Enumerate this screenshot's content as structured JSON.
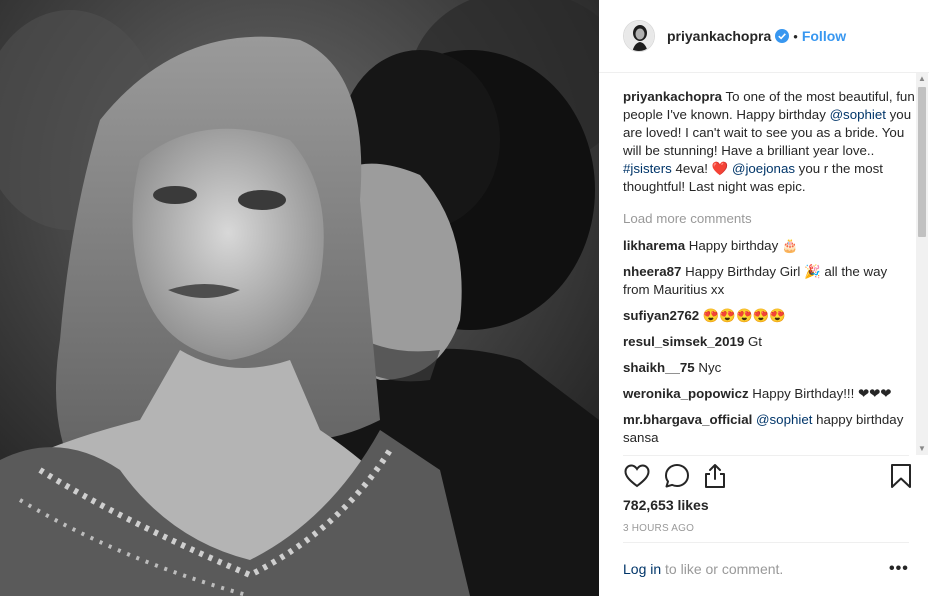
{
  "post": {
    "username": "priyankachopra",
    "follow_label": "Follow",
    "separator": "•",
    "caption": {
      "username": "priyankachopra",
      "text1": " To one of the most beautiful, fun people I've known. Happy birthday ",
      "mention1": "@sophiet",
      "text2": " you are loved! I can't wait to see you as a bride. You will be stunning! Have a brilliant year love.. ",
      "hashtag": "#jsisters",
      "text3": " 4eva! ❤️ ",
      "mention2": "@joejonas",
      "text4": " you r the most thoughtful! Last night was epic."
    },
    "load_more_label": "Load more comments",
    "comments": [
      {
        "user": "likharema",
        "text": " Happy birthday 🎂"
      },
      {
        "user": "nheera87",
        "text": " Happy Birthday Girl 🎉 all the way from Mauritius xx"
      },
      {
        "user": "sufiyan2762",
        "text": " 😍😍😍😍😍"
      },
      {
        "user": "resul_simsek_2019",
        "text": " Gt"
      },
      {
        "user": "shaikh__75",
        "text": " Nyc"
      },
      {
        "user": "weronika_popowicz",
        "text": " Happy Birthday!!! ❤❤❤"
      }
    ],
    "last_comment": {
      "user": "mr.bhargava_official",
      "mention": "@sophiet",
      "text": " happy birthday sansa"
    },
    "likes": "782,653 likes",
    "time": "3 HOURS AGO",
    "footer": {
      "login": "Log in",
      "rest": " to like or comment.",
      "more": "•••"
    }
  },
  "colors": {
    "link": "#003569",
    "follow": "#3897f0",
    "muted": "#999999",
    "verified": "#3897f0"
  }
}
